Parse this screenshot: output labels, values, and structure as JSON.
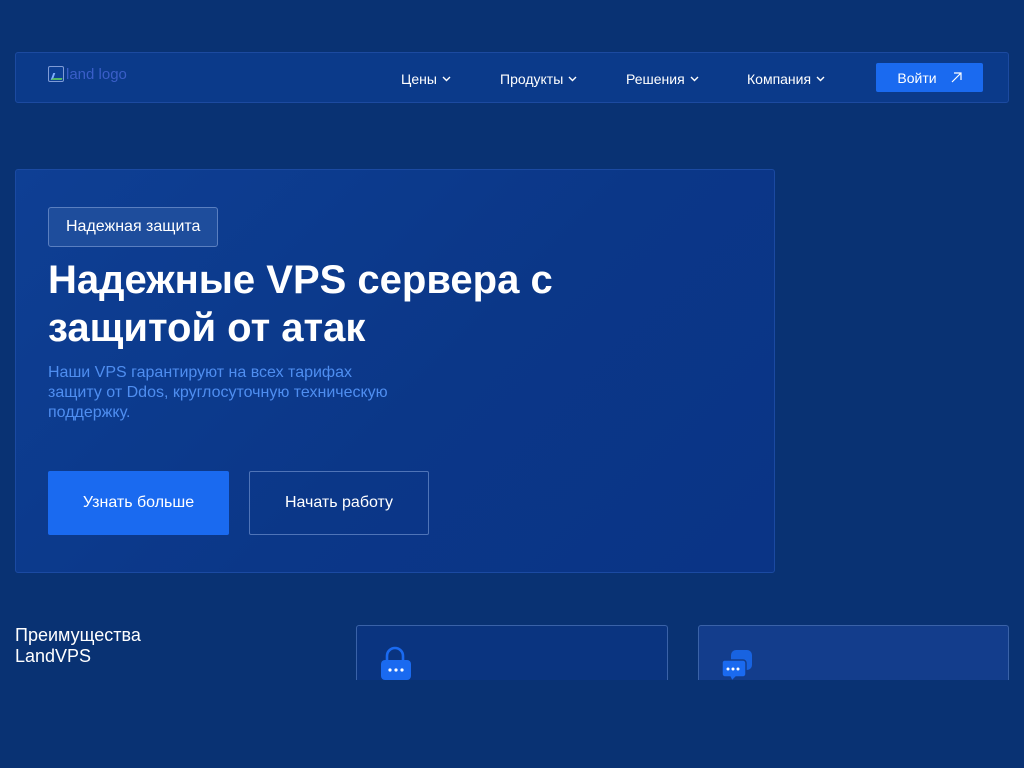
{
  "header": {
    "logo_alt": "land logo",
    "nav": [
      {
        "label": "Цены"
      },
      {
        "label": "Продукты"
      },
      {
        "label": "Решения"
      },
      {
        "label": "Компания"
      }
    ],
    "login_label": "Войти"
  },
  "hero": {
    "badge": "Надежная защита",
    "title": "Надежные VPS сервера с защитой от атак",
    "description": "Наши VPS гарантируют на всех тарифах защиту от Ddos, круглосуточную техническую поддержку.",
    "primary_button": "Узнать больше",
    "secondary_button": "Начать работу"
  },
  "advantages": {
    "title": "Преимущества LandVPS",
    "cards": [
      {
        "icon": "lock-icon"
      },
      {
        "icon": "chat-bubbles-icon"
      }
    ]
  },
  "colors": {
    "background": "#093273",
    "accent": "#1a6af0",
    "description_text": "#4f8ef0"
  }
}
